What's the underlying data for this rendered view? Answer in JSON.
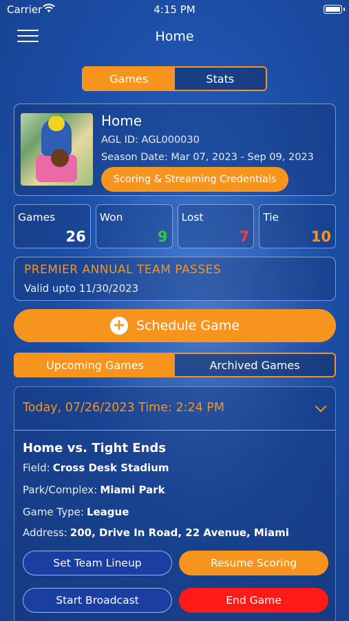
{
  "status_bar": {
    "carrier": "Carrier",
    "time": "4:15 PM"
  },
  "header": {
    "title": "Home"
  },
  "top_tabs": [
    {
      "label": "Games",
      "active": true
    },
    {
      "label": "Stats",
      "active": false
    }
  ],
  "team": {
    "name": "Home",
    "agl_id": "AGL ID: AGL000030",
    "season": "Season Date: Mar 07, 2023 - Sep 09, 2023",
    "credentials_button": "Scoring & Streaming Credentials"
  },
  "stats": [
    {
      "label": "Games",
      "value": "26",
      "color": "#ffffff"
    },
    {
      "label": "Won",
      "value": "9",
      "color": "#2ecc40"
    },
    {
      "label": "Lost",
      "value": "7",
      "color": "#ff3b3b"
    },
    {
      "label": "Tie",
      "value": "10",
      "color": "#f7941d"
    }
  ],
  "pass": {
    "title": "PREMIER ANNUAL TEAM PASSES",
    "valid": "Valid upto 11/30/2023"
  },
  "schedule_button": "Schedule Game",
  "game_tabs": [
    {
      "label": "Upcoming Games",
      "active": true
    },
    {
      "label": "Archived Games",
      "active": false
    }
  ],
  "game": {
    "date_time": "Today, 07/26/2023 Time: 2:24 PM",
    "matchup": "Home vs. Tight Ends",
    "field_label": "Field:",
    "field_value": "Cross Desk Stadium",
    "park_label": "Park/Complex:",
    "park_value": "Miami Park",
    "type_label": "Game Type:",
    "type_value": "League",
    "address_label": "Address:",
    "address_value": "200, Drive In Road, 22 Avenue, Miami",
    "buttons": {
      "lineup": "Set Team Lineup",
      "resume": "Resume Scoring",
      "broadcast": "Start Broadcast",
      "end": "End Game"
    }
  },
  "colors": {
    "accent": "#f7941d",
    "danger": "#ff1a1a",
    "navy": "#1b3ea3"
  }
}
